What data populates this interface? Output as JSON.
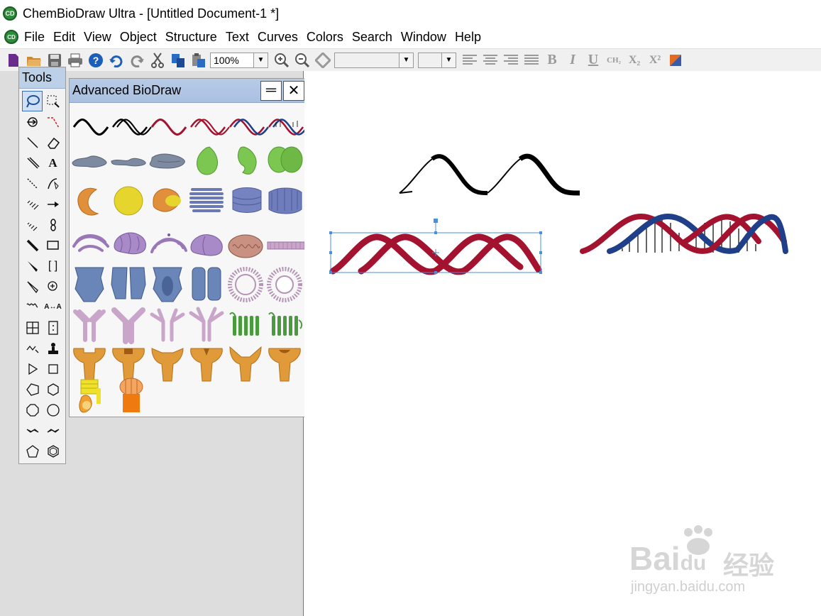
{
  "window": {
    "title": "ChemBioDraw Ultra - [Untitled Document-1 *]",
    "icon": "cd-app-icon"
  },
  "menu": [
    "File",
    "Edit",
    "View",
    "Object",
    "Structure",
    "Text",
    "Curves",
    "Colors",
    "Search",
    "Window",
    "Help"
  ],
  "toolbar": {
    "zoom": "100%",
    "font_value": "",
    "size_value": "",
    "chem_subscript": "CH₂",
    "subscript": "X₂",
    "superscript": "X²"
  },
  "tools_palette": {
    "title": "Tools"
  },
  "biodraw_palette": {
    "title": "Advanced BioDraw",
    "minimize_label": "═",
    "close_label": "✕",
    "items": [
      "dna-single-black",
      "dna-double-black",
      "dna-single-red",
      "dna-double-red",
      "dna-helix-red-blue",
      "dna-helix-ladder",
      "membrane-grey-1",
      "membrane-grey-2",
      "membrane-grey-3",
      "organelle-green-1",
      "organelle-green-2",
      "organelle-green-3",
      "organelle-orange-c",
      "organelle-yellow",
      "organelle-orange-yellow",
      "golgi-blue-1",
      "golgi-blue-2",
      "golgi-blue-3",
      "er-purple-1",
      "er-purple-2",
      "er-purple-3",
      "er-purple-4",
      "mitochondrion",
      "membrane-strip",
      "channel-blue-1",
      "channel-blue-2",
      "channel-blue-3",
      "channel-blue-4",
      "micelle-1",
      "micelle-2",
      "antibody-1",
      "antibody-2",
      "antibody-3",
      "antibody-4",
      "receptor-green-1",
      "receptor-green-2",
      "enzyme-orange-1",
      "enzyme-orange-2",
      "enzyme-orange-3",
      "enzyme-orange-4",
      "enzyme-orange-5",
      "enzyme-orange-6",
      "atp-synthase-yellow",
      "ion-channel-orange"
    ]
  },
  "colors": {
    "titlebar_bg": "#bcd0e8",
    "dna_red": "#a3122e",
    "dna_blue": "#1f3f88",
    "selection": "#4a90d9"
  },
  "watermark": {
    "brand": "Bai",
    "paw": "du",
    "cn": "经验",
    "url": "jingyan.baidu.com"
  }
}
